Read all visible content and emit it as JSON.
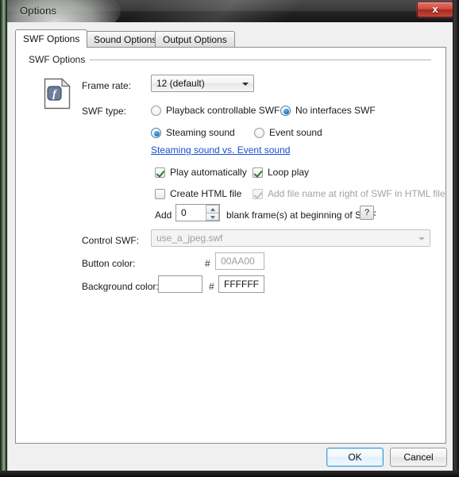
{
  "window": {
    "title": "Options",
    "close_label": "x"
  },
  "tabs": [
    {
      "label": "SWF Options",
      "active": true
    },
    {
      "label": "Sound Options",
      "active": false
    },
    {
      "label": "Output Options",
      "active": false
    }
  ],
  "group": {
    "title": "SWF Options",
    "icon": "swf-document-icon"
  },
  "fields": {
    "frame_rate_label": "Frame rate:",
    "frame_rate_value": "12 (default)",
    "swf_type_label": "SWF type:",
    "radio_playback": "Playback controllable SWF",
    "radio_no_interfaces": "No interfaces SWF",
    "radio_steaming": "Steaming sound",
    "radio_event": "Event sound",
    "link_compare": "Steaming sound vs. Event sound",
    "check_play_auto": "Play automatically",
    "check_loop_play": "Loop play",
    "check_create_html": "Create HTML file",
    "check_add_filename": "Add file name at right of SWF in HTML file",
    "add_prefix": "Add",
    "blank_frames_value": "0",
    "add_suffix": "blank frame(s) at beginning of SWF",
    "help_label": "?",
    "control_swf_label": "Control SWF:",
    "control_swf_value": "use_a_jpeg.swf",
    "button_color_label": "Button color:",
    "button_color_hash": "#",
    "button_color_value": "00AA00",
    "background_color_label": "Background color:",
    "background_color_hash": "#",
    "background_color_value": "FFFFFF"
  },
  "states": {
    "radio_playback_checked": false,
    "radio_no_interfaces_checked": true,
    "radio_steaming_checked": true,
    "radio_event_checked": false,
    "check_play_auto_checked": true,
    "check_loop_play_checked": true,
    "check_create_html_checked": false,
    "check_add_filename_checked": true,
    "check_add_filename_disabled": true,
    "control_swf_disabled": true,
    "button_color_disabled": true
  },
  "footer": {
    "ok_label": "OK",
    "cancel_label": "Cancel"
  },
  "colors": {
    "accent_blue": "#3d9ad6",
    "link_blue": "#1a4fcf",
    "button_color_swatch": "#00AA00",
    "background_color_swatch": "#FFFFFF",
    "close_red": "#cf4a3e"
  }
}
